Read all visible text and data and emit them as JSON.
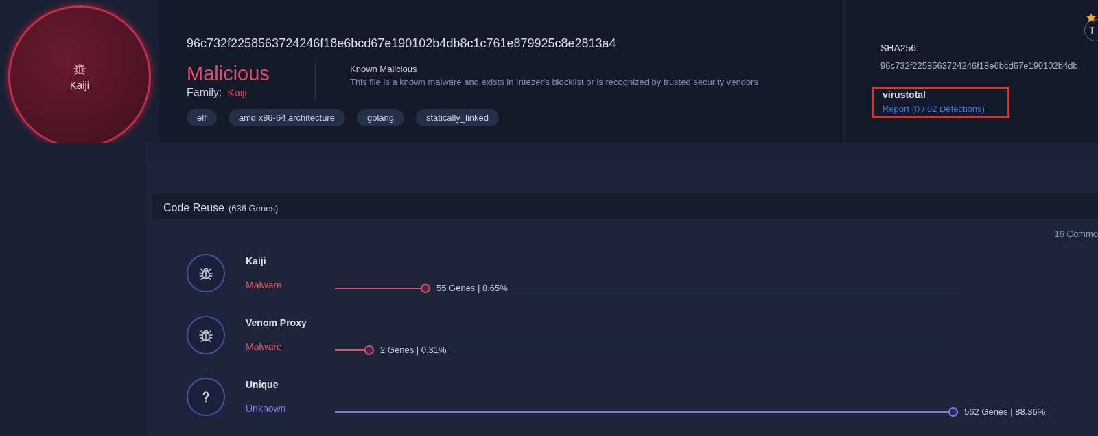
{
  "verdict_badge": {
    "family": "Kaiji"
  },
  "header": {
    "hash": "96c732f2258563724246f18e6bcd67e190102b4db8c1c761e879925c8e2813a4",
    "verdict": "Malicious",
    "family_label": "Family:",
    "family": "Kaiji",
    "verdict_title": "Known Malicious",
    "verdict_description": "This file is a known malware and exists in Intezer's blocklist or is recognized by trusted security vendors",
    "tags": [
      "elf",
      "amd x86-64 architecture",
      "golang",
      "statically_linked"
    ]
  },
  "side_panel": {
    "sha_label": "SHA256:",
    "sha_value": "96c732f2258563724246f18e6bcd67e190102b4db",
    "avatar_letter": "T",
    "virustotal": {
      "title": "virustotal",
      "link": "Report (0 / 62 Detections)",
      "highlighted": true
    }
  },
  "code_reuse": {
    "title": "Code Reuse",
    "count": "(636 Genes)",
    "common_label": "16 Commo",
    "rows": [
      {
        "kind": "malware",
        "name": "Kaiji",
        "type": "Malware",
        "level": 0.137,
        "reading": "55 Genes | 8.65%"
      },
      {
        "kind": "malware",
        "name": "Venom Proxy",
        "type": "Malware",
        "level": 0.047,
        "reading": "2 Genes | 0.31%"
      },
      {
        "kind": "unknown",
        "name": "Unique",
        "type": "Unknown",
        "level": 0.98,
        "reading": "562 Genes | 88.36%"
      }
    ]
  }
}
